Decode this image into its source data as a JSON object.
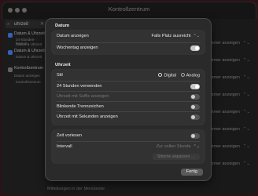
{
  "window": {
    "title": "Kontrollzentrum"
  },
  "search": {
    "value": "uhrzeit"
  },
  "sidebar": {
    "items": [
      {
        "label": "Datum & Uhrzeit"
      },
      {
        "label": "Datum & Uhrzeit"
      },
      {
        "label": "Kontrollzentrum"
      }
    ],
    "subs": [
      "24-Stunden-Format",
      "Datum & Uhrzeit",
      "Datum & Uhrzeit",
      "Datum anzeigen",
      "Kontrollzentrum"
    ]
  },
  "background": {
    "rows": [
      "Immer anzeigen",
      "Immer anzeigen",
      "Immer anzeigen",
      "Immer anzeigen",
      "Immer anzeigen",
      "Immer anzeigen",
      "Immer anzeigen",
      "Immer anzeigen"
    ],
    "bottom": "Mitteilungen in der Menüleiste"
  },
  "sheet": {
    "datum": {
      "header": "Datum",
      "datum_anzeigen": "Datum anzeigen",
      "datum_value": "Falls Platz ausreicht",
      "wochentag": "Wochentag anzeigen"
    },
    "uhrzeit": {
      "header": "Uhrzeit",
      "stil": "Stil",
      "digital": "Digital",
      "analog": "Analog",
      "rows": [
        "24 Stunden verwenden",
        "Uhrzeit mit Suffix anzeigen",
        "Blinkende Trennzeichen",
        "Uhrzeit mit Sekunden anzeigen"
      ],
      "vorlesen": "Zeit vorlesen",
      "intervall": "Intervall",
      "intervall_value": "Zur vollen Stunde",
      "stimme_button": "Stimme anpassen …"
    },
    "done_button": "Fertig"
  }
}
